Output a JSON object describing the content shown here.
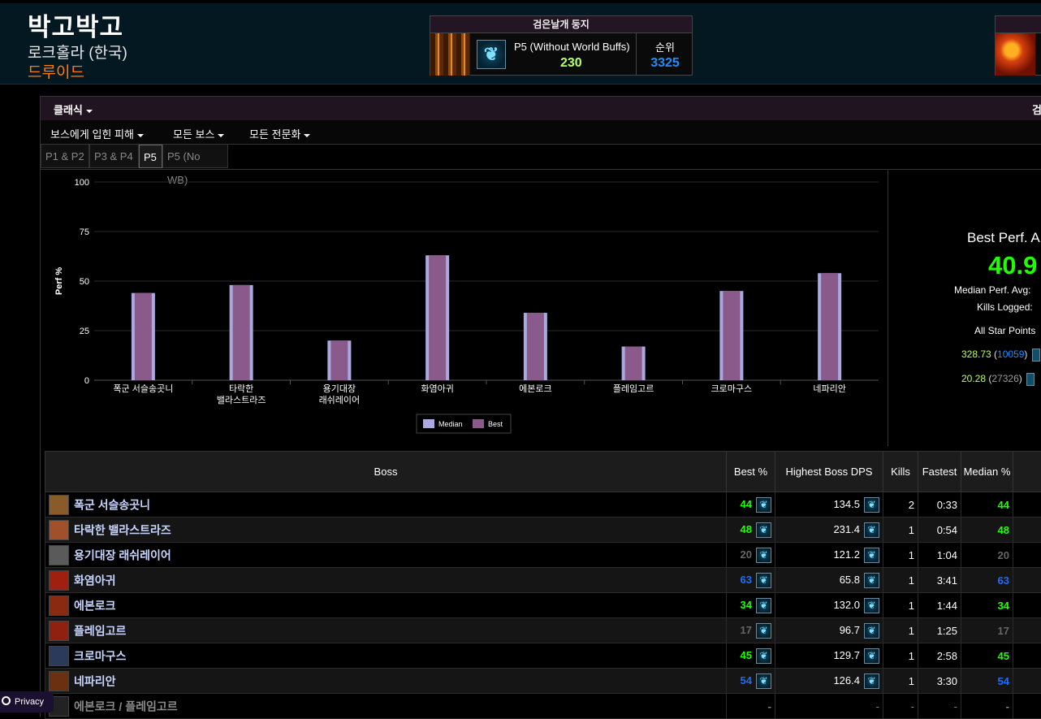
{
  "character": {
    "name": "박고박고",
    "realm": "로크홀라 (한국)",
    "class": "드루이드"
  },
  "zone_box": {
    "title": "검은날개 둥지",
    "spec_icon": "paw-icon",
    "partition_label": "P5 (Without World Buffs)",
    "score": "230",
    "rank_label": "순위",
    "rank": "3325"
  },
  "toolbar": {
    "metric": "클래식",
    "metric_right": "검"
  },
  "filters": {
    "damage": "보스에게 입힌 피해",
    "bosses": "모든 보스",
    "specs": "모든 전문화"
  },
  "partitions": [
    "P1 & P2",
    "P3 & P4",
    "P5",
    "P5 (No WB)"
  ],
  "chart_data": {
    "type": "bar",
    "categories": [
      [
        "폭군 서슬송곳니"
      ],
      [
        "타락한",
        "밸라스트라즈"
      ],
      [
        "용기대장",
        "래쉬레이어"
      ],
      [
        "화염아귀"
      ],
      [
        "에본로크"
      ],
      [
        "플레임고르"
      ],
      [
        "크로마구스"
      ],
      [
        "네파리안"
      ]
    ],
    "series": [
      {
        "name": "Median",
        "values": [
          44,
          48,
          20,
          63,
          34,
          17,
          45,
          54
        ],
        "color": "#a9a9e0"
      },
      {
        "name": "Best",
        "values": [
          44,
          48,
          20,
          63,
          34,
          17,
          45,
          54
        ],
        "color": "#8a5a8a"
      }
    ],
    "ylabel": "Perf %",
    "ylim": [
      0,
      100
    ],
    "yticks": [
      0,
      25,
      50,
      75,
      100
    ],
    "legend_position": "bottom"
  },
  "summary": {
    "best_perf_label": "Best Perf. A",
    "best_perf_value": "40.9",
    "median_label": "Median Perf. Avg:",
    "kills_label": "Kills Logged:",
    "star_label": "All Star Points",
    "star_rows": [
      {
        "value": "328.73",
        "rank": "10059",
        "rank_color": "blue"
      },
      {
        "value": "20.28",
        "rank": "27326",
        "rank_color": "gray"
      }
    ]
  },
  "table": {
    "headers": [
      "Boss",
      "Best %",
      "Highest Boss DPS",
      "Kills",
      "Fastest",
      "Median %"
    ],
    "rows": [
      {
        "boss": "폭군 서슬송곳니",
        "best": "44",
        "best_color": "green",
        "dps": "134.5",
        "kills": "2",
        "fastest": "0:33",
        "median": "44",
        "icon_color": "#8a5a2a"
      },
      {
        "boss": "타락한 밸라스트라즈",
        "best": "48",
        "best_color": "green",
        "dps": "231.4",
        "kills": "1",
        "fastest": "0:54",
        "median": "48",
        "icon_color": "#a0502a"
      },
      {
        "boss": "용기대장 래쉬레이어",
        "best": "20",
        "best_color": "gray",
        "dps": "121.2",
        "kills": "1",
        "fastest": "1:04",
        "median": "20",
        "icon_color": "#5a5a5a"
      },
      {
        "boss": "화염아귀",
        "best": "63",
        "best_color": "blue",
        "dps": "65.8",
        "kills": "1",
        "fastest": "3:41",
        "median": "63",
        "icon_color": "#a02010"
      },
      {
        "boss": "에본로크",
        "best": "34",
        "best_color": "green",
        "dps": "132.0",
        "kills": "1",
        "fastest": "1:44",
        "median": "34",
        "icon_color": "#8a2a10"
      },
      {
        "boss": "플레임고르",
        "best": "17",
        "best_color": "gray",
        "dps": "96.7",
        "kills": "1",
        "fastest": "1:25",
        "median": "17",
        "icon_color": "#902010"
      },
      {
        "boss": "크로마구스",
        "best": "45",
        "best_color": "green",
        "dps": "129.7",
        "kills": "1",
        "fastest": "2:58",
        "median": "45",
        "icon_color": "#2a3a5a"
      },
      {
        "boss": "네파리안",
        "best": "54",
        "best_color": "blue",
        "dps": "126.4",
        "kills": "1",
        "fastest": "3:30",
        "median": "54",
        "icon_color": "#6a3010"
      },
      {
        "boss": "에본로크 / 플레임고르",
        "best": "-",
        "best_color": "dash",
        "dps": "-",
        "kills": "-",
        "fastest": "-",
        "median": "-",
        "icon_color": "#222",
        "dim": true
      }
    ]
  },
  "privacy": {
    "label": "Privacy"
  }
}
